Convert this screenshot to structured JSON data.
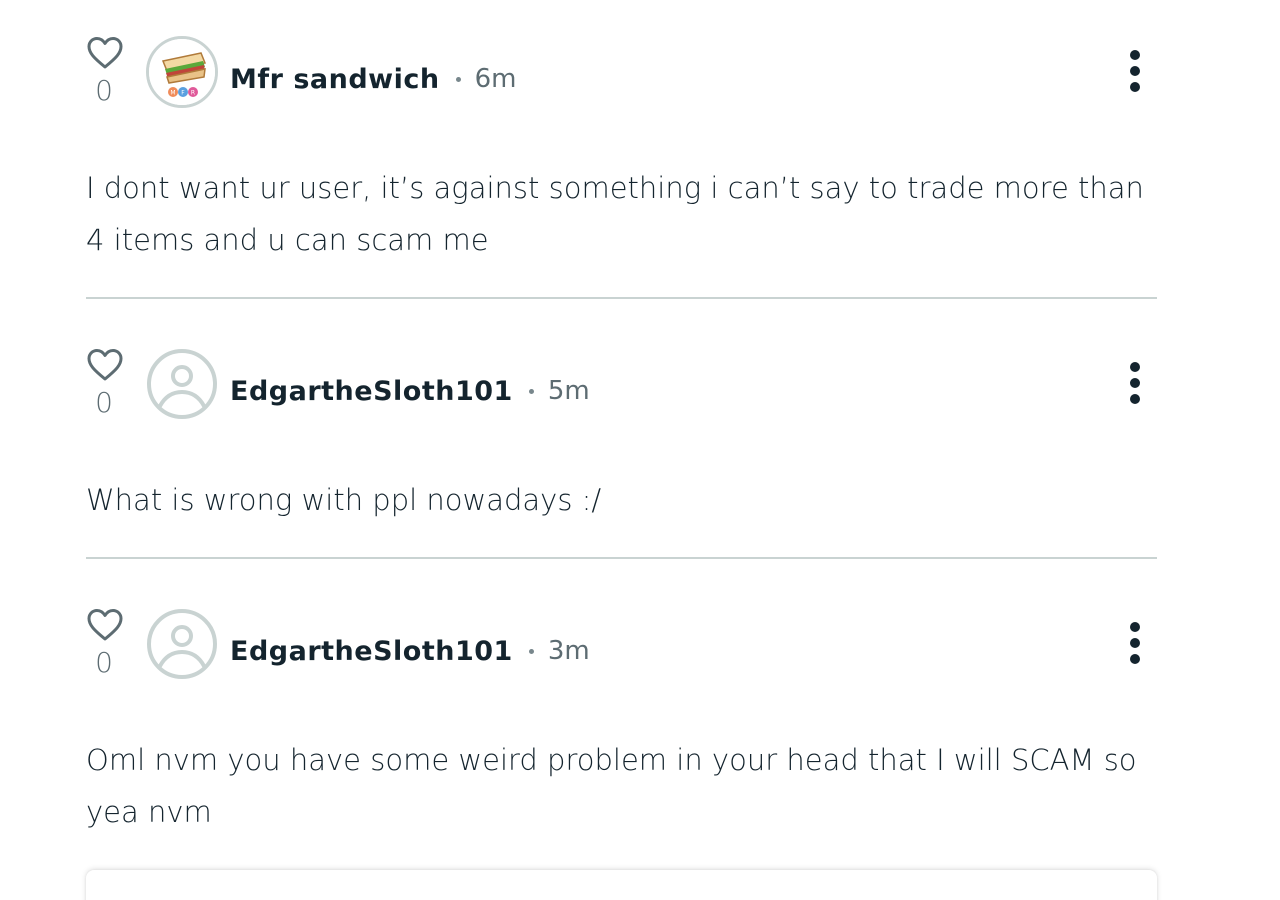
{
  "comments": [
    {
      "likes": "0",
      "username": "Mfr sandwich",
      "time": "6m",
      "avatar": "sandwich-avatar-image",
      "text": "I dont want ur user, it’s against something i can’t say to trade more than 4 items and u can scam me"
    },
    {
      "likes": "0",
      "username": "EdgartheSloth101",
      "time": "5m",
      "avatar": "default-user-avatar",
      "text": "What is wrong with ppl nowadays :/"
    },
    {
      "likes": "0",
      "username": "EdgartheSloth101",
      "time": "3m",
      "avatar": "default-user-avatar",
      "text": "Oml nvm you have some weird problem in your head that I will SCAM so yea nvm"
    }
  ],
  "icons": {
    "like": "heart-icon",
    "menu": "more-vertical-icon"
  },
  "colors": {
    "text": "#14242e",
    "muted": "#5d6c72",
    "divider": "#c9d3d2",
    "avatar_placeholder": "#c9d3d2"
  }
}
